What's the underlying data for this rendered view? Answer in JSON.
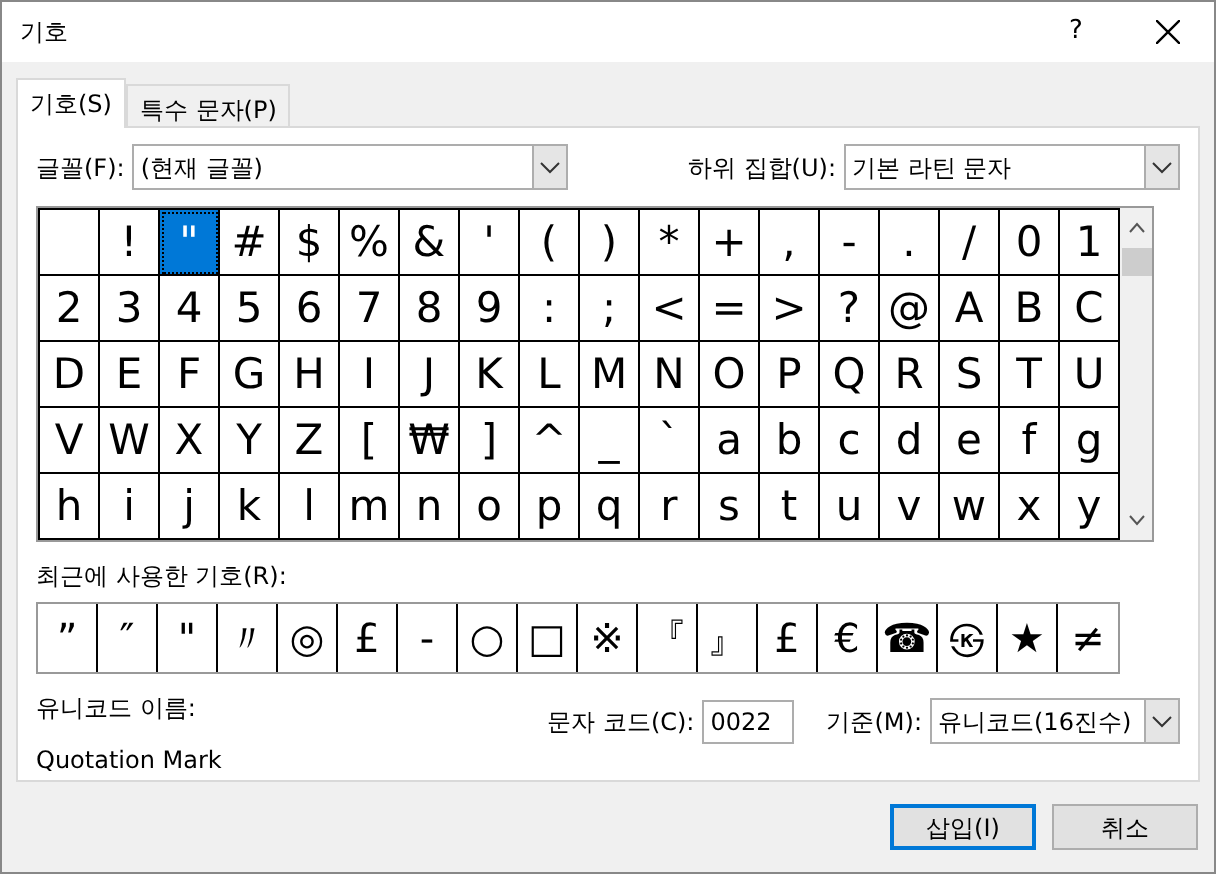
{
  "window": {
    "title": "기호",
    "help": "?"
  },
  "tabs": [
    {
      "label": "기호(S)",
      "selected": true
    },
    {
      "label": "특수 문자(P)",
      "selected": false
    }
  ],
  "font_field": {
    "label": "글꼴(F):",
    "value": "(현재 글꼴)"
  },
  "subset_field": {
    "label": "하위 집합(U):",
    "value": "기본 라틴 문자"
  },
  "symbol_grid": {
    "cells": [
      {
        "selected": false
      },
      {
        "char": "!",
        "selected": false
      },
      {
        "char": "\"",
        "selected": true
      },
      {
        "char": "#",
        "selected": false
      },
      {
        "char": "$",
        "selected": false
      },
      {
        "char": "%",
        "selected": false
      },
      {
        "char": "&",
        "selected": false
      },
      {
        "char": "'",
        "selected": false
      },
      {
        "char": "(",
        "selected": false
      },
      {
        "char": ")",
        "selected": false
      },
      {
        "char": "*",
        "selected": false
      },
      {
        "char": "+",
        "selected": false
      },
      {
        "char": ",",
        "selected": false
      },
      {
        "char": "-",
        "selected": false
      },
      {
        "char": ".",
        "selected": false
      },
      {
        "char": "/",
        "selected": false
      },
      {
        "char": "0",
        "selected": false
      },
      {
        "char": "1",
        "selected": false
      },
      {
        "char": "2",
        "selected": false
      },
      {
        "char": "3",
        "selected": false
      },
      {
        "char": "4",
        "selected": false
      },
      {
        "char": "5",
        "selected": false
      },
      {
        "char": "6",
        "selected": false
      },
      {
        "char": "7",
        "selected": false
      },
      {
        "char": "8",
        "selected": false
      },
      {
        "char": "9",
        "selected": false
      },
      {
        "char": ":",
        "selected": false
      },
      {
        "char": ";",
        "selected": false
      },
      {
        "char": "<",
        "selected": false
      },
      {
        "char": "=",
        "selected": false
      },
      {
        "char": ">",
        "selected": false
      },
      {
        "char": "?",
        "selected": false
      },
      {
        "char": "@",
        "selected": false
      },
      {
        "char": "A",
        "selected": false
      },
      {
        "char": "B",
        "selected": false
      },
      {
        "char": "C",
        "selected": false
      },
      {
        "char": "D",
        "selected": false
      },
      {
        "char": "E",
        "selected": false
      },
      {
        "char": "F",
        "selected": false
      },
      {
        "char": "G",
        "selected": false
      },
      {
        "char": "H",
        "selected": false
      },
      {
        "char": "I",
        "selected": false
      },
      {
        "char": "J",
        "selected": false
      },
      {
        "char": "K",
        "selected": false
      },
      {
        "char": "L",
        "selected": false
      },
      {
        "char": "M",
        "selected": false
      },
      {
        "char": "N",
        "selected": false
      },
      {
        "char": "O",
        "selected": false
      },
      {
        "char": "P",
        "selected": false
      },
      {
        "char": "Q",
        "selected": false
      },
      {
        "char": "R",
        "selected": false
      },
      {
        "char": "S",
        "selected": false
      },
      {
        "char": "T",
        "selected": false
      },
      {
        "char": "U",
        "selected": false
      },
      {
        "char": "V",
        "selected": false
      },
      {
        "char": "W",
        "selected": false
      },
      {
        "char": "X",
        "selected": false
      },
      {
        "char": "Y",
        "selected": false
      },
      {
        "char": "Z",
        "selected": false
      },
      {
        "char": "[",
        "selected": false
      },
      {
        "char": "₩",
        "selected": false
      },
      {
        "char": "]",
        "selected": false
      },
      {
        "char": "^",
        "selected": false
      },
      {
        "char": "_",
        "selected": false
      },
      {
        "char": "`",
        "selected": false
      },
      {
        "char": "a",
        "selected": false
      },
      {
        "char": "b",
        "selected": false
      },
      {
        "char": "c",
        "selected": false
      },
      {
        "char": "d",
        "selected": false
      },
      {
        "char": "e",
        "selected": false
      },
      {
        "char": "f",
        "selected": false
      },
      {
        "char": "g",
        "selected": false
      },
      {
        "char": "h",
        "selected": false
      },
      {
        "char": "i",
        "selected": false
      },
      {
        "char": "j",
        "selected": false
      },
      {
        "char": "k",
        "selected": false
      },
      {
        "char": "l",
        "selected": false
      },
      {
        "char": "m",
        "selected": false
      },
      {
        "char": "n",
        "selected": false
      },
      {
        "char": "o",
        "selected": false
      },
      {
        "char": "p",
        "selected": false
      },
      {
        "char": "q",
        "selected": false
      },
      {
        "char": "r",
        "selected": false
      },
      {
        "char": "s",
        "selected": false
      },
      {
        "char": "t",
        "selected": false
      },
      {
        "char": "u",
        "selected": false
      },
      {
        "char": "v",
        "selected": false
      },
      {
        "char": "w",
        "selected": false
      },
      {
        "char": "x",
        "selected": false
      },
      {
        "char": "y",
        "selected": false
      }
    ]
  },
  "recent": {
    "label": "최근에 사용한 기호(R):",
    "symbols": [
      "”",
      "″",
      "\"",
      "〃",
      "◎",
      "£",
      "-",
      "○",
      "□",
      "※",
      "『",
      "』",
      "£",
      "€",
      "☎",
      "㉿",
      "★",
      "≠"
    ]
  },
  "unicode_name": {
    "label": "유니코드 이름:",
    "value": "Quotation Mark"
  },
  "char_code": {
    "label": "문자 코드(C):",
    "value": "0022"
  },
  "from_field": {
    "label": "기준(M):",
    "value": "유니코드(16진수)"
  },
  "buttons": [
    {
      "label": "삽입(I)",
      "default": true
    },
    {
      "label": "취소",
      "default": false
    }
  ]
}
